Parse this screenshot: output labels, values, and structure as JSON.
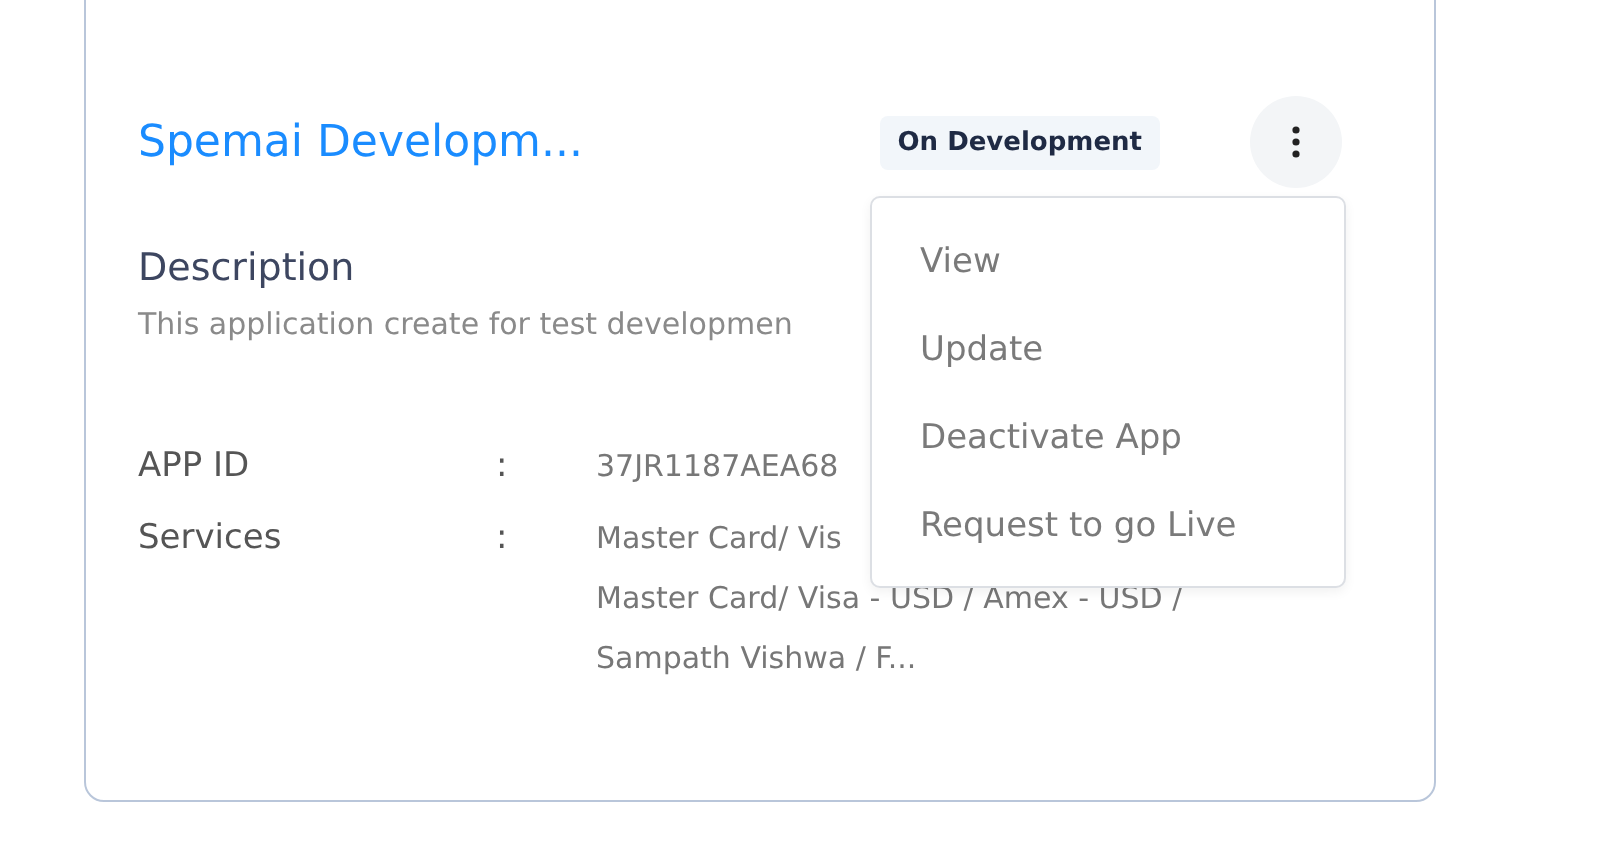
{
  "card": {
    "title": "Spemai Developm...",
    "status": "On Development",
    "description_label": "Description",
    "description": "This application create for test developmen",
    "fields": [
      {
        "label": "APP ID",
        "separator": ":",
        "lines": [
          "37JR1187AEA68"
        ]
      },
      {
        "label": "Services",
        "separator": ":",
        "lines": [
          "Master Card/ Vis",
          "Master Card/ Visa - USD / Amex - USD /",
          "Sampath Vishwa / F..."
        ]
      }
    ]
  },
  "menu": {
    "items": [
      "View",
      "Update",
      "Deactivate App",
      "Request to go Live"
    ]
  }
}
